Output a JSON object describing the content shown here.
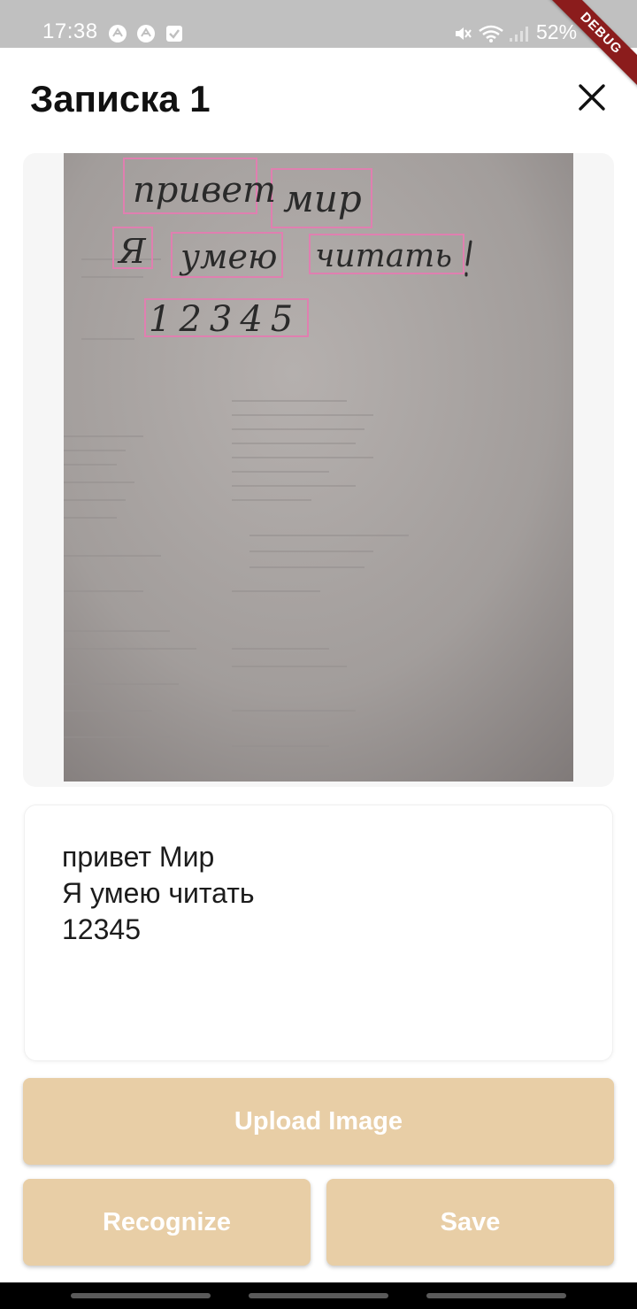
{
  "status_bar": {
    "time": "17:38",
    "battery": "52%"
  },
  "debug_banner": "DEBUG",
  "header": {
    "title": "Записка 1"
  },
  "photo": {
    "recognized_words": [
      "привет",
      "мир",
      "Я",
      "умею",
      "читать",
      "12345"
    ]
  },
  "result": {
    "lines": [
      "привет Мир",
      "Я умею читать",
      "12345"
    ]
  },
  "buttons": {
    "upload": "Upload Image",
    "recognize": "Recognize",
    "save": "Save"
  },
  "colors": {
    "accent": "#e8cea6",
    "box_outline": "#e07fb0"
  }
}
